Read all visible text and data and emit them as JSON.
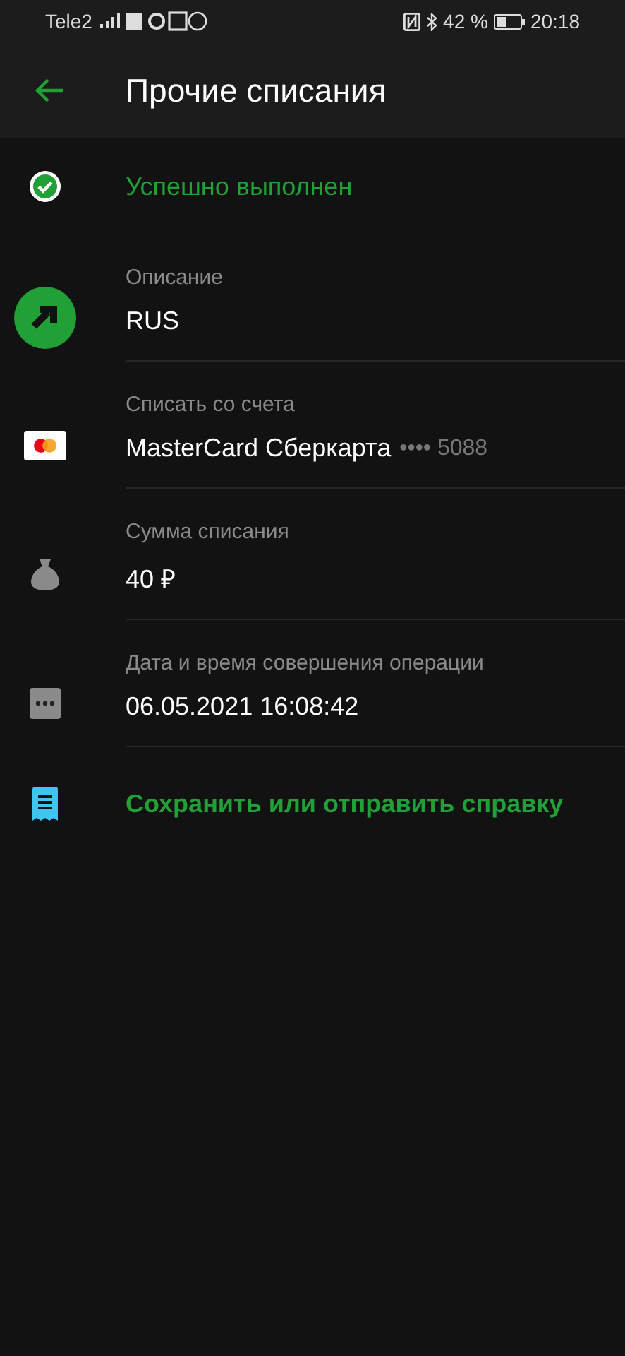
{
  "status_bar": {
    "carrier": "Tele2",
    "battery": "42 %",
    "time": "20:18"
  },
  "toolbar": {
    "title": "Прочие списания"
  },
  "items": [
    {
      "kind": "status",
      "text": "Успешно выполнен"
    },
    {
      "kind": "detail",
      "label": "Описание",
      "value": "RUS"
    },
    {
      "kind": "detail",
      "label": "Списать со счета",
      "value": "MasterCard Сберкарта",
      "suffix": "•••• 5088"
    },
    {
      "kind": "detail",
      "label": "Сумма списания",
      "value": "40 ₽"
    },
    {
      "kind": "detail",
      "label": "Дата и время совершения операции",
      "value": "06.05.2021 16:08:42"
    },
    {
      "kind": "action",
      "text": "Сохранить или отправить справку"
    }
  ]
}
